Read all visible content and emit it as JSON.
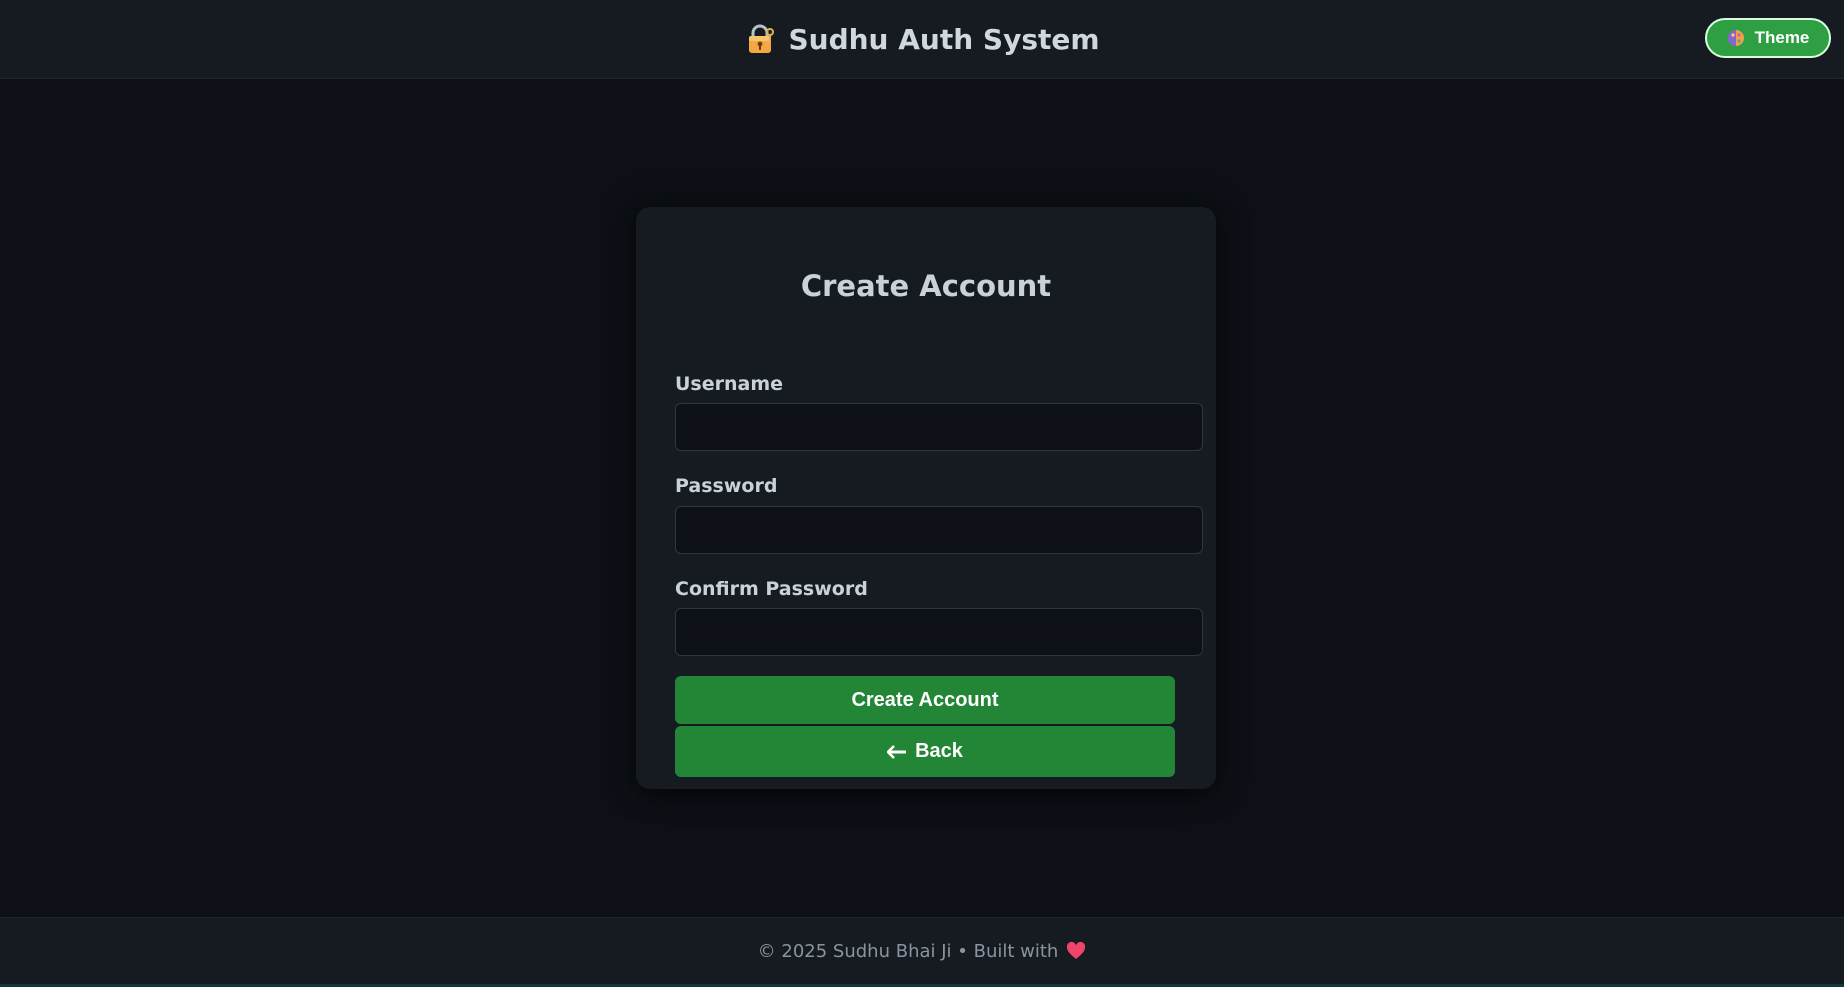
{
  "header": {
    "title": "Sudhu Auth System",
    "brand_icon": "lock-with-key-icon",
    "theme_button": {
      "label": "Theme",
      "icon": "palette-icon"
    }
  },
  "form": {
    "title": "Create Account",
    "fields": [
      {
        "label": "Username",
        "value": "",
        "placeholder": ""
      },
      {
        "label": "Password",
        "value": "",
        "placeholder": ""
      },
      {
        "label": "Confirm Password",
        "value": "",
        "placeholder": ""
      }
    ],
    "submit_label": "Create Account",
    "back_label": "Back",
    "back_icon": "arrow-left-icon"
  },
  "footer": {
    "text": "© 2025 Sudhu Bhai Ji • Built with",
    "icon": "heart-icon"
  },
  "colors": {
    "accent": "#238636",
    "background": "#0d1117",
    "surface": "#161b22"
  }
}
